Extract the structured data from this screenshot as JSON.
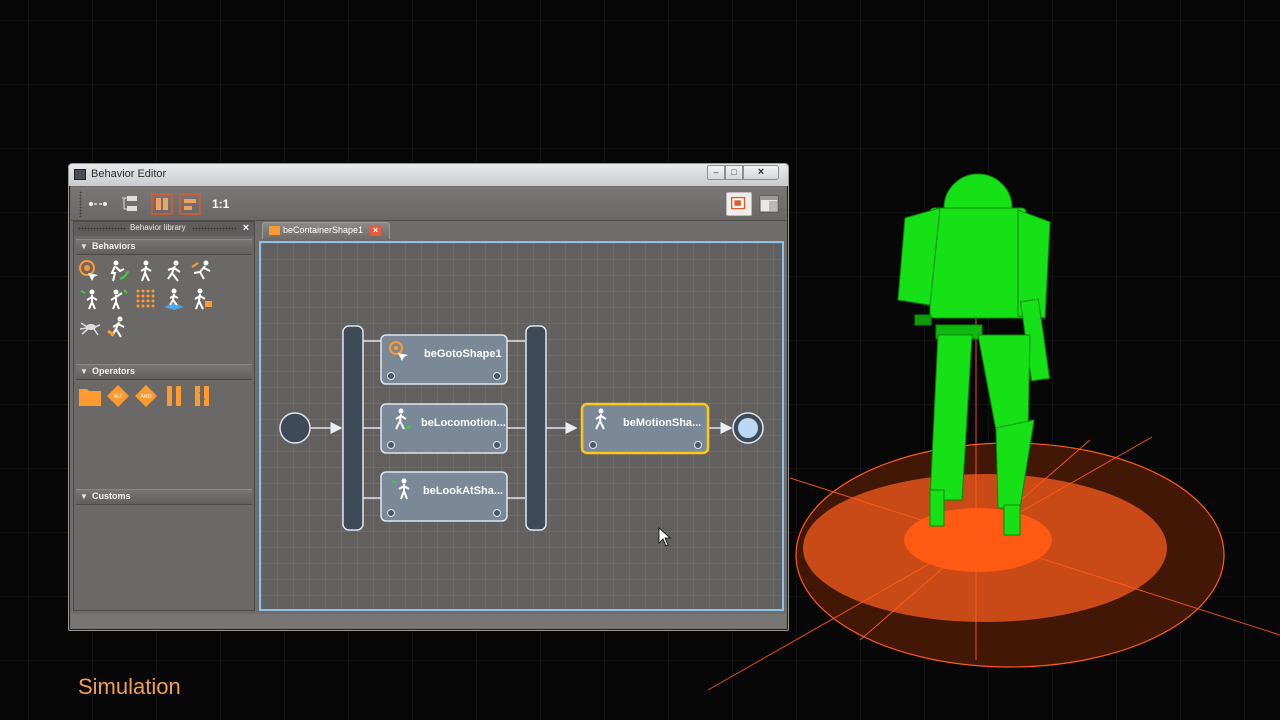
{
  "window": {
    "title": "Behavior Editor",
    "close_glyph": "×",
    "min_glyph": "–",
    "max_glyph": "□"
  },
  "toolbar": {
    "zoom_label": "1:1",
    "icons": [
      "link-tool-icon",
      "layout-tool-icon",
      "align-columns-icon",
      "align-rows-icon",
      "overview-icon",
      "layout-switch-icon"
    ]
  },
  "library": {
    "title": "Behavior library",
    "close_glyph": "×",
    "sections": [
      {
        "label": "Behaviors"
      },
      {
        "label": "Operators"
      },
      {
        "label": "Customs"
      }
    ],
    "operator_badges": [
      "ALT",
      "AND"
    ]
  },
  "tab": {
    "label": "beContainerShape1",
    "close_glyph": "×"
  },
  "graph": {
    "nodes": [
      {
        "label": "beGotoShape1"
      },
      {
        "label": "beLocomotion..."
      },
      {
        "label": "beLookAtSha..."
      },
      {
        "label": "beMotionSha..."
      }
    ]
  },
  "caption": "Simulation",
  "colors": {
    "accent_orange": "#ff9a2e",
    "character_green": "#16e016",
    "selection_yellow": "#ffc61a",
    "canvas_border_blue": "#8fc0e6"
  }
}
